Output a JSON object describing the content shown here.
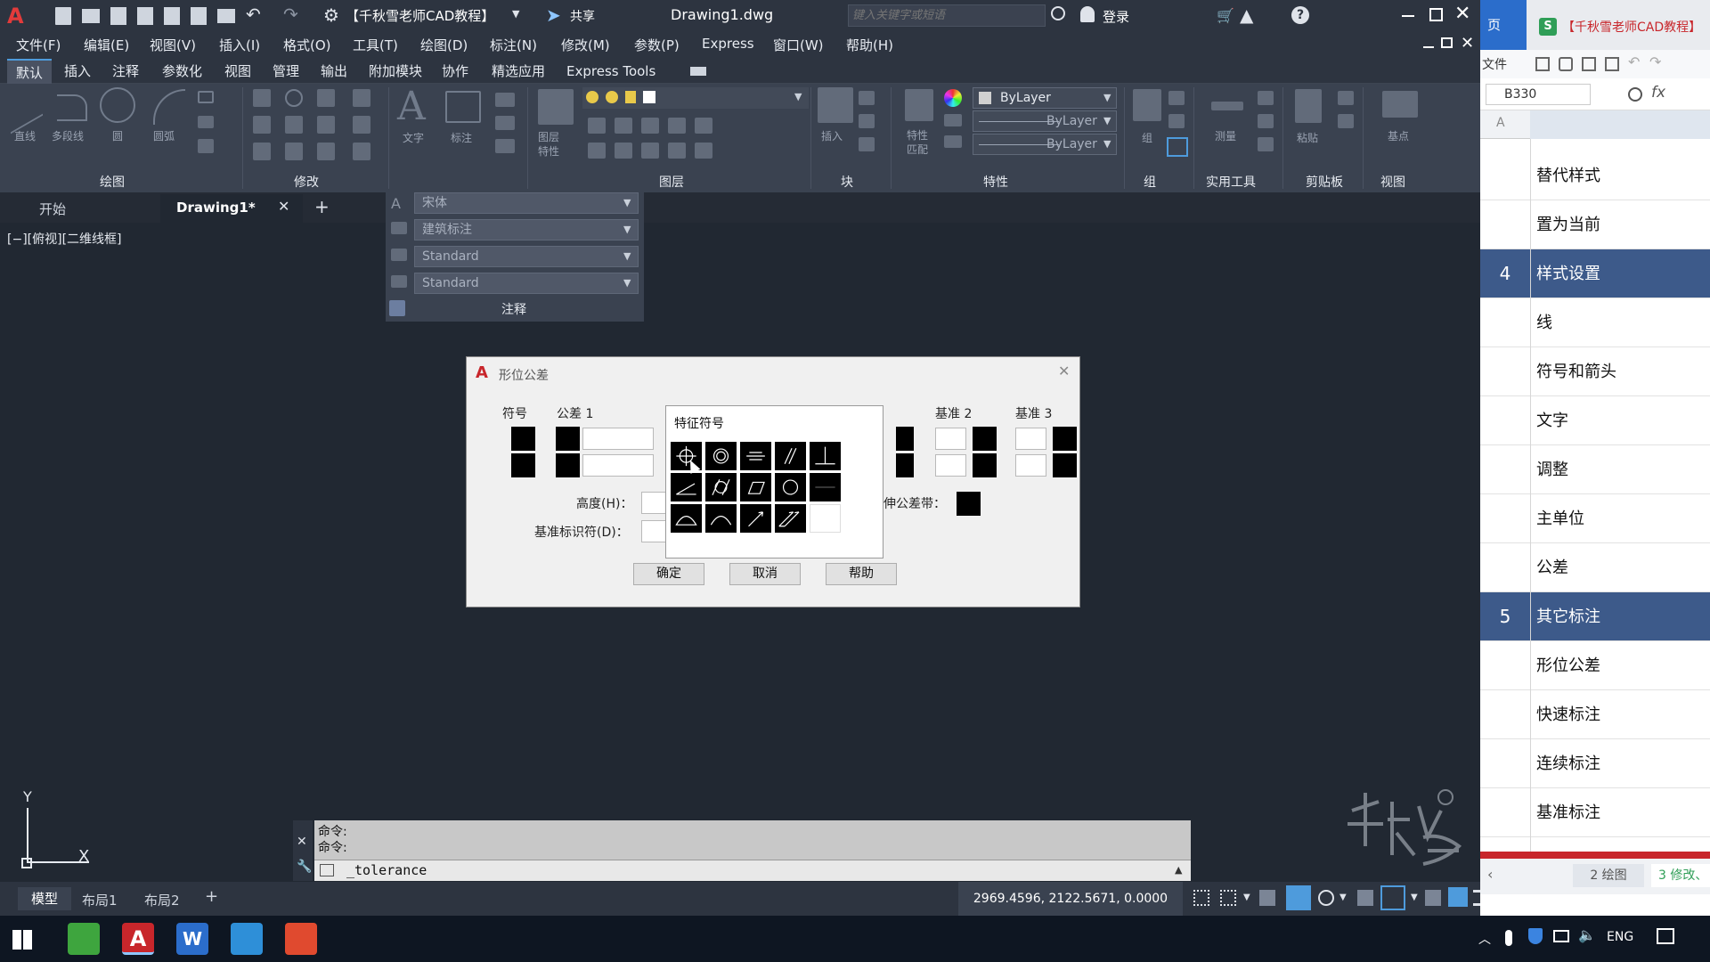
{
  "titlebar": {
    "workspace": "【千秋雪老师CAD教程】",
    "share": "共享",
    "doc_title": "Drawing1.dwg",
    "search_placeholder": "键入关键字或短语",
    "login": "登录"
  },
  "menubar": [
    "文件(F)",
    "编辑(E)",
    "视图(V)",
    "插入(I)",
    "格式(O)",
    "工具(T)",
    "绘图(D)",
    "标注(N)",
    "修改(M)",
    "参数(P)",
    "Express",
    "窗口(W)",
    "帮助(H)"
  ],
  "ribbon_tabs": [
    "默认",
    "插入",
    "注释",
    "参数化",
    "视图",
    "管理",
    "输出",
    "附加模块",
    "协作",
    "精选应用",
    "Express Tools"
  ],
  "ribbon": {
    "draw_tools": [
      "直线",
      "多段线",
      "圆",
      "圆弧"
    ],
    "text_tools": [
      "文字",
      "标注"
    ],
    "layer_tools": [
      "图层\n特性"
    ],
    "block_tools": [
      "插入"
    ],
    "prop_tools": [
      "特性\n匹配"
    ],
    "group_tools": [
      "组"
    ],
    "measure": "测量",
    "paste": "粘贴",
    "base": "基点",
    "bylayer": "ByLayer",
    "panels": [
      "绘图",
      "修改",
      "图层",
      "块",
      "特性",
      "组",
      "实用工具",
      "剪贴板",
      "视图"
    ]
  },
  "annotation_panel": {
    "text_style": "宋体",
    "dim_style": "建筑标注",
    "leader_style": "Standard",
    "table_style": "Standard",
    "label": "注释"
  },
  "doc_tabs": {
    "start": "开始",
    "drawing": "Drawing1*"
  },
  "viewport_label": "[−][俯视][二维线框]",
  "dialog": {
    "title": "形位公差",
    "col_symbol": "符号",
    "col_tol1": "公差 1",
    "col_datum2": "基准 2",
    "col_datum3": "基准 3",
    "height_label": "高度(H)：",
    "datum_id_label": "基准标识符(D)：",
    "projected_zone_label": "伸公差带：",
    "ok": "确定",
    "cancel": "取消",
    "help": "帮助"
  },
  "symbol_popup": {
    "title": "特征符号",
    "symbols": [
      "position",
      "concentricity",
      "symmetry",
      "parallelism",
      "perpendicularity",
      "angularity",
      "cylindricity",
      "flatness",
      "circularity",
      "straightness",
      "profile-of-surface",
      "profile-of-line",
      "circular-runout",
      "total-runout",
      "blank"
    ]
  },
  "command_line": {
    "history": [
      "命令:",
      "命令:"
    ],
    "input": "_tolerance"
  },
  "layout_tabs": [
    "模型",
    "布局1",
    "布局2"
  ],
  "status": {
    "coords": "2969.4596, 2122.5671, 0.0000"
  },
  "ucs": {
    "y_label": "Y",
    "x_label": "X"
  },
  "right_panel": {
    "top_tab": "页",
    "doc_title": "【千秋雪老师CAD教程】",
    "menu_file": "文件",
    "cell_ref": "B330",
    "fx": "fx",
    "col_header": "A",
    "rows": [
      {
        "num": "",
        "text": "替代样式",
        "section": false
      },
      {
        "num": "",
        "text": "置为当前",
        "section": false
      },
      {
        "num": "4",
        "text": "样式设置",
        "section": true
      },
      {
        "num": "",
        "text": "线",
        "section": false
      },
      {
        "num": "",
        "text": "符号和箭头",
        "section": false
      },
      {
        "num": "",
        "text": "文字",
        "section": false
      },
      {
        "num": "",
        "text": "调整",
        "section": false
      },
      {
        "num": "",
        "text": "主单位",
        "section": false
      },
      {
        "num": "",
        "text": "公差",
        "section": false
      },
      {
        "num": "5",
        "text": "其它标注",
        "section": true
      },
      {
        "num": "",
        "text": "形位公差",
        "section": false
      },
      {
        "num": "",
        "text": "快速标注",
        "section": false
      },
      {
        "num": "",
        "text": "连续标注",
        "section": false
      },
      {
        "num": "",
        "text": "基准标注",
        "section": false
      }
    ],
    "sheet_tabs": [
      "2 绘图",
      "3 修改、"
    ]
  },
  "taskbar": {
    "lang": "ENG"
  },
  "colors": {
    "accent": "#4e9bdc",
    "section_blue": "#3d5a8a",
    "autocad_red": "#c8262b",
    "wps_green": "#2f9e57"
  }
}
